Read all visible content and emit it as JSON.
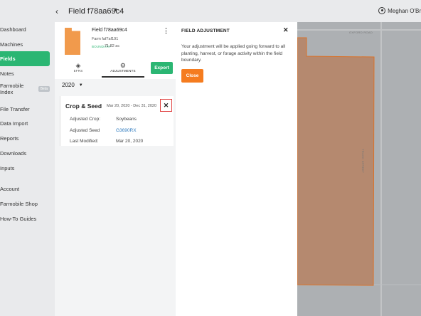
{
  "header": {
    "back_icon": "chevron-left-icon",
    "title": "Field f78aa69c4",
    "user_name": "Meghan O'Br"
  },
  "sidebar": {
    "items": [
      {
        "label": "Dashboard",
        "active": false
      },
      {
        "label": "Machines",
        "active": false
      },
      {
        "label": "Fields",
        "active": true
      },
      {
        "label": "Notes",
        "active": false
      },
      {
        "label": "Farmobile Index",
        "badge": "Beta",
        "active": false
      },
      {
        "label": "File Transfer",
        "active": false
      },
      {
        "label": "Data Import",
        "active": false
      },
      {
        "label": "Reports",
        "active": false
      },
      {
        "label": "Downloads",
        "active": false
      },
      {
        "label": "Inputs",
        "active": false
      },
      {
        "label": "Account",
        "active": false
      },
      {
        "label": "Farmobile Shop",
        "active": false
      },
      {
        "label": "How-To Guides",
        "active": false
      }
    ]
  },
  "field_panel": {
    "field_name": "Field f78aa69c4",
    "farm_name": "Farm faf7af191",
    "boundary_label": "BOUNDARY",
    "acres": "71.82 ac",
    "tabs": [
      {
        "label": "EFRS",
        "icon": "layers-icon"
      },
      {
        "label": "ADJUSTMENTS",
        "icon": "gear-icon",
        "active": true
      }
    ],
    "export_label": "Export",
    "year": "2020",
    "card": {
      "title": "Crop & Seed",
      "dates": "Mar 20, 2020 - Dec 31, 2020",
      "rows": [
        {
          "label": "Adjusted Crop:",
          "value": "Soybeans"
        },
        {
          "label": "Adjusted Seed",
          "value": "G3690RX",
          "link": true
        },
        {
          "label": "Last Modified:",
          "value": "Mar 20, 2020"
        }
      ]
    }
  },
  "dialog": {
    "title": "FIELD ADJUSTMENT",
    "body": "Your adjustment will be applied going forward to all planting, harvest, or forage activity within the field boundary.",
    "button_label": "Close"
  },
  "map": {
    "road_labels": [
      "OXFORD ROAD",
      "TRUCK STREET"
    ],
    "colors": {
      "boundary_fill": "#b5896f",
      "boundary_stroke": "#d9722a",
      "map_bg": "#adb0b3"
    }
  },
  "colors": {
    "accent_green": "#2bb673",
    "accent_orange": "#f57c1f",
    "highlight_red": "#e0403f",
    "link_blue": "#2f7bbf"
  }
}
